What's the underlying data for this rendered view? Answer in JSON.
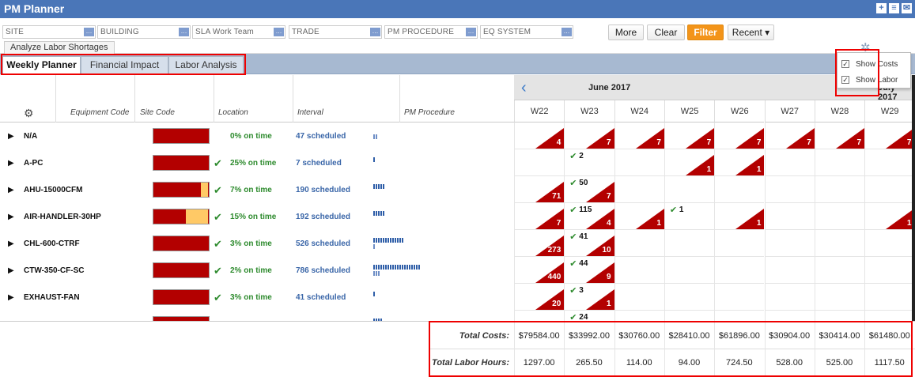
{
  "app": {
    "title": "PM Planner"
  },
  "filters": [
    {
      "text": "SITE"
    },
    {
      "text": "BUILDING"
    },
    {
      "text": "SLA  Work  Team"
    },
    {
      "text": "TRADE"
    },
    {
      "text": "PM PROCEDURE"
    },
    {
      "text": "EQ SYSTEM"
    }
  ],
  "buttons": {
    "more": "More",
    "clear": "Clear",
    "filter": "Filter",
    "recent": "Recent ▾"
  },
  "analyze_label": "Analyze Labor Shortages",
  "tabs": [
    {
      "label": "Weekly Planner",
      "active": true
    },
    {
      "label": "Financial Impact",
      "active": false
    },
    {
      "label": "Labor Analysis",
      "active": false
    }
  ],
  "popup": {
    "show_costs": {
      "label": "Show Costs",
      "checked": true
    },
    "show_labor": {
      "label": "Show Labor",
      "checked": true
    }
  },
  "columns": {
    "equipment_code": "Equipment Code",
    "site_code": "Site Code",
    "location": "Location",
    "interval": "Interval",
    "pm_procedure": "PM Procedure"
  },
  "calendar": {
    "months": [
      {
        "label": "June 2017"
      },
      {
        "label": "July 2017"
      }
    ],
    "weeks": [
      "W22",
      "W23",
      "W24",
      "W25",
      "W26",
      "W27",
      "W28",
      "W29"
    ]
  },
  "rows": [
    {
      "name": "N/A",
      "bar_yellow": 0,
      "check": false,
      "pct": "0% on time",
      "sched": "47 scheduled",
      "spark": 0,
      "spark_outline": 2,
      "cells": [
        {
          "t": "4"
        },
        {
          "t": "7"
        },
        {
          "t": "7"
        },
        {
          "t": "7"
        },
        {
          "t": "7"
        },
        {
          "t": "7"
        },
        {
          "t": "7"
        },
        {
          "t": "7"
        }
      ]
    },
    {
      "name": "A-PC",
      "bar_yellow": 0,
      "check": true,
      "pct": "25% on time",
      "sched": "7 scheduled",
      "spark": 1,
      "spark_outline": 0,
      "cells": [
        null,
        {
          "g": "2"
        },
        null,
        {
          "t": "1"
        },
        {
          "t": "1"
        },
        null,
        null,
        null
      ]
    },
    {
      "name": "AHU-15000CFM",
      "bar_yellow": 0.12,
      "check": true,
      "pct": "7% on time",
      "sched": "190 scheduled",
      "spark": 5,
      "spark_outline": 0,
      "cells": [
        {
          "t": "71"
        },
        {
          "g": "50",
          "t": "7"
        },
        null,
        null,
        null,
        null,
        null,
        null
      ]
    },
    {
      "name": "AIR-HANDLER-30HP",
      "bar_yellow": 0.4,
      "check": true,
      "pct": "15% on time",
      "sched": "192 scheduled",
      "spark": 5,
      "spark_outline": 0,
      "cells": [
        {
          "t": "7"
        },
        {
          "g": "115",
          "t": "4"
        },
        {
          "t": "1"
        },
        {
          "g": "1"
        },
        {
          "t": "1"
        },
        null,
        null,
        {
          "t": "1"
        }
      ]
    },
    {
      "name": "CHL-600-CTRF",
      "bar_yellow": 0,
      "check": true,
      "pct": "3% on time",
      "sched": "526 scheduled",
      "spark": 13,
      "spark_outline": 1,
      "cells": [
        {
          "t": "273"
        },
        {
          "g": "41",
          "t": "10"
        },
        null,
        null,
        null,
        null,
        null,
        null
      ]
    },
    {
      "name": "CTW-350-CF-SC",
      "bar_yellow": 0,
      "check": true,
      "pct": "2% on time",
      "sched": "786 scheduled",
      "spark": 20,
      "spark_outline": 3,
      "cells": [
        {
          "t": "440"
        },
        {
          "g": "44",
          "t": "9"
        },
        null,
        null,
        null,
        null,
        null,
        null
      ]
    },
    {
      "name": "EXHAUST-FAN",
      "bar_yellow": 0,
      "check": true,
      "pct": "3% on time",
      "sched": "41 scheduled",
      "spark": 1,
      "spark_outline": 0,
      "cells": [
        {
          "t": "20"
        },
        {
          "g": "3",
          "t": "1"
        },
        null,
        null,
        null,
        null,
        null,
        null
      ]
    },
    {
      "name": "",
      "bar_yellow": 0,
      "check": true,
      "pct": "",
      "sched": "",
      "spark": 4,
      "spark_outline": 0,
      "cells": [
        null,
        {
          "g": "24"
        },
        null,
        null,
        null,
        null,
        null,
        null
      ]
    }
  ],
  "totals": {
    "costs_label": "Total Costs:",
    "labor_label": "Total Labor Hours:",
    "costs": [
      "$79584.00",
      "$33992.00",
      "$30760.00",
      "$28410.00",
      "$61896.00",
      "$30904.00",
      "$30414.00",
      "$61480.00"
    ],
    "labor": [
      "1297.00",
      "265.50",
      "114.00",
      "94.00",
      "724.50",
      "528.00",
      "525.00",
      "1117.50"
    ]
  },
  "colors": {
    "header": "#4a76b8",
    "late": "#b30000",
    "ontime": "#2e8b2e",
    "filter": "#f39419"
  }
}
